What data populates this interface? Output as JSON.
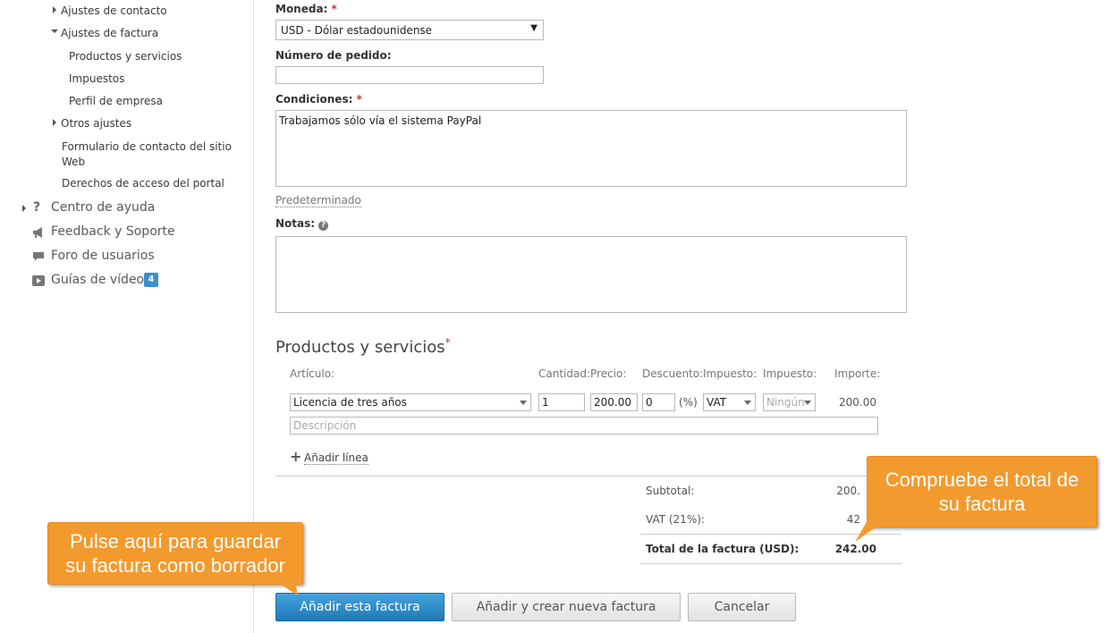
{
  "sidebar": {
    "contact_settings": "Ajustes de contacto",
    "invoice_settings": "Ajustes de factura",
    "products_services": "Productos y servicios",
    "taxes": "Impuestos",
    "company_profile": "Perfil de empresa",
    "other_settings": "Otros ajustes",
    "website_contact_form_line1": "Formulario de contacto del sitio",
    "website_contact_form_line2": "Web",
    "portal_access": "Derechos de acceso del portal",
    "help_center": "Centro de ayuda",
    "feedback": "Feedback y Soporte",
    "forum": "Foro de usuarios",
    "video_guides": "Guías de vídeo",
    "video_guides_badge": "4"
  },
  "form": {
    "currency_label": "Moneda:",
    "currency_value": "USD - Dólar estadounidense",
    "order_number_label": "Número de pedido:",
    "order_number_value": "",
    "conditions_label": "Condiciones:",
    "conditions_value": "Trabajamos sólo vía el sistema PayPal",
    "default_link": "Predeterminado",
    "notes_label": "Notas:",
    "notes_help_icon": "?",
    "notes_value": "",
    "required_mark": "*"
  },
  "products": {
    "section_title": "Productos y servicios",
    "columns": {
      "item": "Artículo:",
      "quantity": "Cantidad:",
      "price": "Precio:",
      "discount": "Descuento:",
      "tax1": "Impuesto:",
      "tax2": "Impuesto:",
      "amount": "Importe:"
    },
    "line": {
      "item": "Licencia de tres años",
      "quantity": "1",
      "price": "200.00",
      "discount": "0",
      "discount_unit": "(%)",
      "tax1": "VAT",
      "tax2": "Ningún",
      "amount": "200.00",
      "description_placeholder": "Descripción"
    },
    "add_line": "Añadir línea"
  },
  "totals": {
    "subtotal_label": "Subtotal:",
    "subtotal_value": "200.",
    "vat_label": "VAT (21%):",
    "vat_value": "42",
    "total_label": "Total de la factura (USD):",
    "total_value": "242.00"
  },
  "buttons": {
    "add_invoice": "Añadir esta factura",
    "add_and_new": "Añadir y crear nueva factura",
    "cancel": "Cancelar"
  },
  "callouts": {
    "save_draft_line1": "Pulse aquí para guardar",
    "save_draft_line2": "su factura como borrador",
    "check_total_line1": "Compruebe el total de",
    "check_total_line2": "su factura"
  },
  "colors": {
    "callout": "#f39a2e",
    "primary_button": "#1f79b5",
    "required": "#c0392b",
    "badge": "#3b8fd0"
  }
}
